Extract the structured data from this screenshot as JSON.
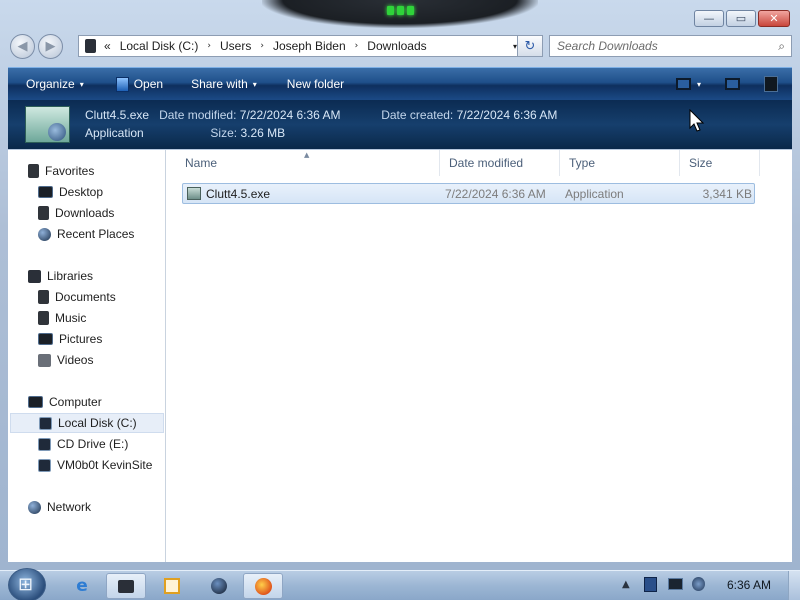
{
  "window": {
    "caption_buttons": {
      "minimize": "—",
      "maximize": "▭",
      "close": "✕"
    }
  },
  "address": {
    "overflow": "«",
    "path": [
      "Local Disk (C:)",
      "Users",
      "Joseph Biden",
      "Downloads"
    ],
    "separator": "›",
    "dropdown": "▾",
    "refresh_icon": "↻"
  },
  "search": {
    "placeholder": "Search Downloads",
    "icon": "⌕"
  },
  "toolbar": {
    "organize": "Organize",
    "open": "Open",
    "share_with": "Share with",
    "new_folder": "New folder",
    "caret": "▾"
  },
  "details": {
    "file_name": "Clutt4.5.exe",
    "modified_label": "Date modified:",
    "modified_value": "7/22/2024 6:36 AM",
    "created_label": "Date created:",
    "created_value": "7/22/2024 6:36 AM",
    "type": "Application",
    "size_label": "Size:",
    "size_value": "3.26 MB"
  },
  "nav": {
    "favorites": {
      "label": "Favorites",
      "items": [
        "Desktop",
        "Downloads",
        "Recent Places"
      ]
    },
    "libraries": {
      "label": "Libraries",
      "items": [
        "Documents",
        "Music",
        "Pictures",
        "Videos"
      ]
    },
    "computer": {
      "label": "Computer",
      "items": [
        "Local Disk (C:)",
        "CD Drive (E:)",
        "VM0b0t KevinSite"
      ],
      "selected_index": 0
    },
    "network": {
      "label": "Network"
    }
  },
  "list": {
    "columns": [
      "Name",
      "Date modified",
      "Type",
      "Size"
    ],
    "sort_indicator": "▲",
    "rows": [
      {
        "name": "Clutt4.5.exe",
        "date_modified": "7/22/2024 6:36 AM",
        "type": "Application",
        "size": "3,341 KB"
      }
    ]
  },
  "taskbar": {
    "clock": "6:36 AM",
    "tray_arrow": "▲",
    "ie_glyph": "e"
  },
  "colors": {
    "toolbar": "#1f4f8a",
    "details_banner": "#0b2b52",
    "selection": "#d6e5f6",
    "taskbar": "#9cb6d4"
  }
}
